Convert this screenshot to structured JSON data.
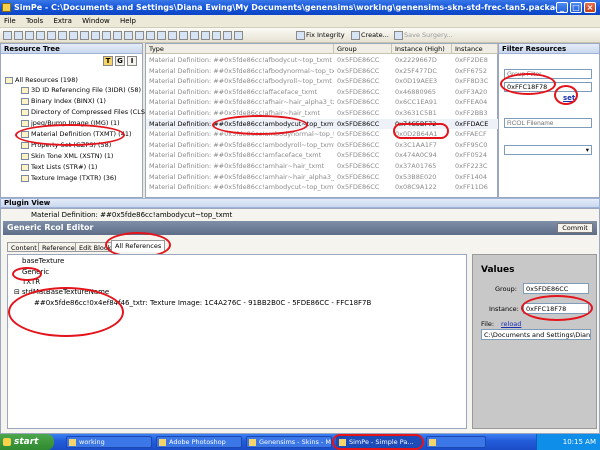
{
  "window": {
    "title": "SimPe - C:\\Documents and Settings\\Diana Ewing\\My Documents\\genensims\\working\\genensims-skn-std-frec-tan5.package"
  },
  "menu": [
    "File",
    "Tools",
    "Extra",
    "Window",
    "Help"
  ],
  "toolbar": {
    "fix_integrity": "Fix Integrity",
    "create": "Create...",
    "save_surgery": "Save Surgery..."
  },
  "resource_tree": {
    "title": "Resource Tree",
    "view_buttons": [
      "T",
      "G",
      "I"
    ],
    "items": [
      "All Resources (198)",
      "3D ID Referencing File (3IDR) (58)",
      "Binary Index (BINX) (1)",
      "Directory of Compressed Files (CLST)",
      "jpeg/Bump Image (IMG) (1)",
      "Material Definition (TXMT) (41)",
      "Property Set (GZPS) (58)",
      "Skin Tone XML (XSTN) (1)",
      "Text Lists (STR#) (1)",
      "Texture Image (TXTR) (36)"
    ]
  },
  "list": {
    "columns": [
      "Type",
      "Group",
      "Instance (High)",
      "Instance"
    ],
    "rows": [
      {
        "type": "Material Definition: ##0x5fde86cc!afbodycut~top_txmt",
        "group": "0x5FDE86CC",
        "high": "0x2229667D",
        "inst": "0xFF2DE8"
      },
      {
        "type": "Material Definition: ##0x5fde86cc!afbodynormal~top_txmt",
        "group": "0x5FDE86CC",
        "high": "0x25F477DC",
        "inst": "0xFF6752"
      },
      {
        "type": "Material Definition: ##0x5fde86cc!afbodyroll~top_txmt",
        "group": "0x5FDE86CC",
        "high": "0x0D19AEE3",
        "inst": "0xFF8D3C"
      },
      {
        "type": "Material Definition: ##0x5fde86cc!affaceface_txmt",
        "group": "0x5FDE86CC",
        "high": "0x46880965",
        "inst": "0xFF3A20"
      },
      {
        "type": "Material Definition: ##0x5fde86cc!afhair~hair_alpha3_txmt",
        "group": "0x5FDE86CC",
        "high": "0x6CC1EA91",
        "inst": "0xFFEA04"
      },
      {
        "type": "Material Definition: ##0x5fde86cc!afhair~hair_txmt",
        "group": "0x5FDE86CC",
        "high": "0x3631C5B1",
        "inst": "0xFF2BB3"
      },
      {
        "type": "Material Definition: ##0x5fde86cc!ambodycut~top_txmt",
        "group": "0x5FDE86CC",
        "high": "0x74C5BF72",
        "inst": "0xFFDACE"
      },
      {
        "type": "Material Definition: ##0x5fde86cc!ambodynormal~top_txmt",
        "group": "0x5FDE86CC",
        "high": "0x0D2B64A1",
        "inst": "0xFFAECF"
      },
      {
        "type": "Material Definition: ##0x5fde86cc!ambodyroll~top_txmt",
        "group": "0x5FDE86CC",
        "high": "0x3C1AA1F7",
        "inst": "0xFF95C0"
      },
      {
        "type": "Material Definition: ##0x5fde86cc!amfaceface_txmt",
        "group": "0x5FDE86CC",
        "high": "0x474A0C94",
        "inst": "0xFF0524"
      },
      {
        "type": "Material Definition: ##0x5fde86cc!amhair~hair_txmt",
        "group": "0x5FDE86CC",
        "high": "0x37A01765",
        "inst": "0xFF223C"
      },
      {
        "type": "Material Definition: ##0x5fde86cc!amhair~hair_alpha3_txmt",
        "group": "0x5FDE86CC",
        "high": "0x53B8E020",
        "inst": "0xFF1404"
      },
      {
        "type": "Material Definition: ##0x5fde86cc!ambodycut~top_txmt",
        "group": "0x5FDE86CC",
        "high": "0x08C9A122",
        "inst": "0xFF11D6"
      }
    ],
    "selected_index": 6
  },
  "filter": {
    "title": "Filter Resources",
    "group_placeholder": "Group Filter",
    "value": "0xFFC18F78",
    "set_label": "set",
    "rcol_placeholder": "RCOL Filename"
  },
  "plugin": {
    "title": "Plugin View",
    "header": "Material Definition: ##0x5fde86cc!ambodycut~top_txmt",
    "editor_title": "Generic Rcol Editor",
    "commit": "Commit",
    "tabs": [
      "Content",
      "Reference",
      "Edit Blocks",
      "All References"
    ],
    "tree": [
      "baseTexture",
      "Generic",
      "TXTR",
      "stdMatBaseTextureName"
    ],
    "tree_leaf": "##0x5fde86cc!0x4ef84f46_txtr: Texture Image: 1C4A276C - 91BB2B0C - 5FDE86CC - FFC18F7B",
    "values": {
      "title": "Values",
      "group_label": "Group:",
      "group": "0x5FDE86CC",
      "instance_label": "Instance:",
      "instance": "0xFFC18F78",
      "file_label": "File:",
      "reload": "reload",
      "file": "C:\\Documents and Settings\\Diana"
    }
  },
  "taskbar": {
    "start": "start",
    "tasks": [
      "working",
      "Adobe Photoshop",
      "Genensims - Skins - M...",
      "SimPe - Simple Pa...",
      ""
    ],
    "clock": "10:15 AM"
  },
  "colors": {
    "accent": "#245edb",
    "annotation": "#e3141b"
  }
}
